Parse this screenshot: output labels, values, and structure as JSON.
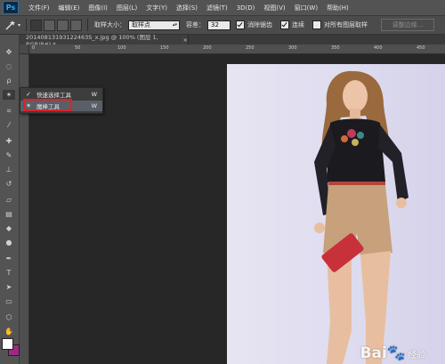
{
  "app": {
    "logo": "Ps"
  },
  "menu": [
    "文件(F)",
    "编辑(E)",
    "图像(I)",
    "图层(L)",
    "文字(Y)",
    "选择(S)",
    "滤镜(T)",
    "3D(D)",
    "视图(V)",
    "窗口(W)",
    "帮助(H)"
  ],
  "options": {
    "tool_icon": "magic-wand-icon",
    "sample_size_label": "取样大小：",
    "sample_size_value": "取样点",
    "tolerance_label": "容差：",
    "tolerance_value": "32",
    "antialias_label": "消除锯齿",
    "antialias_checked": true,
    "contiguous_label": "连续",
    "contiguous_checked": true,
    "sample_all_layers_label": "对所有图层取样",
    "sample_all_layers_checked": false,
    "refine_edge_label": "调整边缘..."
  },
  "document": {
    "tab_title": "20140813193122463S_x.jpg @ 100% (图层 1, RGB/8#) *",
    "close_glyph": "×"
  },
  "ruler": {
    "top_numbers": [
      "0",
      "50",
      "100",
      "150",
      "200",
      "250",
      "300",
      "350",
      "400",
      "450"
    ]
  },
  "flyout": {
    "items": [
      {
        "icon": "quick-selection-icon",
        "label": "快速选择工具",
        "shortcut": "W",
        "selected": false
      },
      {
        "icon": "magic-wand-icon",
        "label": "魔棒工具",
        "shortcut": "W",
        "selected": true
      }
    ]
  },
  "colors": {
    "foreground": "#ffffff",
    "background": "#9c2a84",
    "highlight_box": "#d8242c"
  },
  "watermark": {
    "brand": "Bai",
    "suffix": "经验"
  }
}
